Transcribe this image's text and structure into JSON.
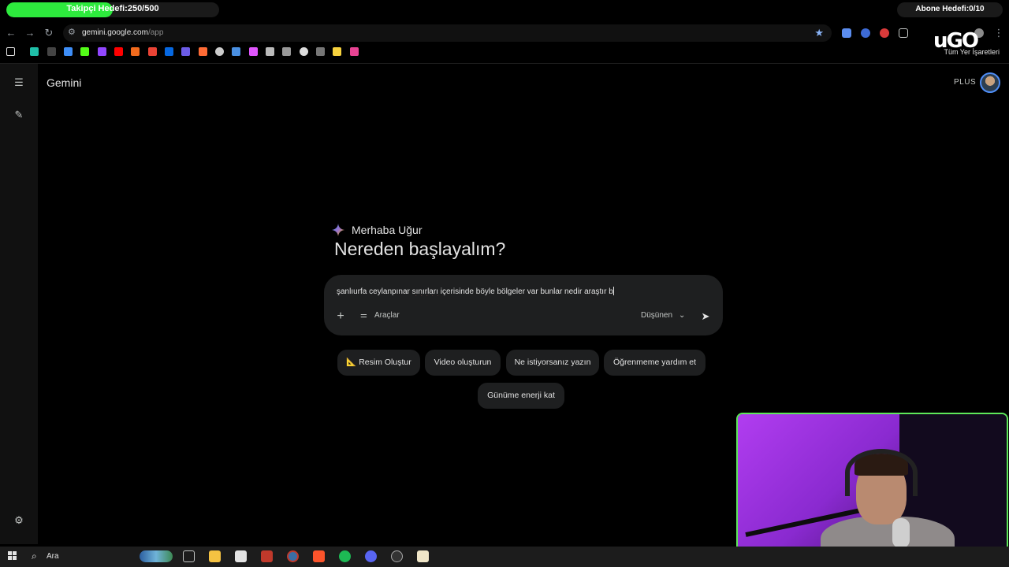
{
  "overlay": {
    "follower_goal_text": "Takipçi Hedefi:250/500",
    "follower_progress": 0.5,
    "subscriber_goal_text": "Abone Hedefi:0/10",
    "stream_logo": "uGO"
  },
  "browser": {
    "url_host": "gemini.google.com",
    "url_path": "/app",
    "all_bookmarks_label": "Tüm Yer İşaretleri",
    "bookmarked": true
  },
  "app": {
    "title": "Gemini",
    "plan_badge": "PLUS",
    "greeting": "Merhaba Uğur",
    "headline": "Nereden başlayalım?",
    "prompt": {
      "text_part1": "şanlıurfa ceylanpınar ",
      "text_part2": "sınırları",
      "text_part3": " içerisinde böyle bölgeler var bunlar nedir araştır b",
      "tools_label": "Araçlar",
      "model_label": "Düşünen"
    },
    "chips": [
      {
        "label": "📐 Resim Oluştur"
      },
      {
        "label": "Video oluşturun"
      },
      {
        "label": "Ne istiyorsanız yazın"
      },
      {
        "label": "Öğrenmeme yardım et"
      },
      {
        "label": "Günüme enerji kat"
      }
    ]
  },
  "taskbar": {
    "search_label": "Ara"
  },
  "colors": {
    "background": "#000000",
    "surface": "#1e1f20",
    "text": "#e3e3e3",
    "accent_blue": "#8ab4f8",
    "follower_green": "#2dea3d",
    "cam_border": "#5ee85a"
  }
}
